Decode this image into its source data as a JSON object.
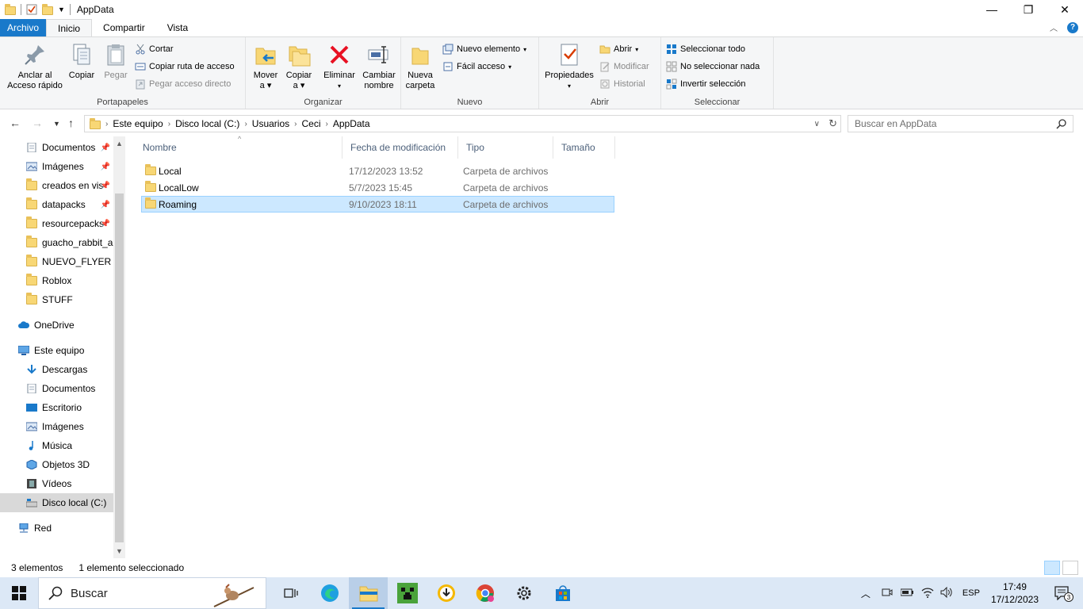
{
  "window": {
    "title": "AppData",
    "minimize": "—",
    "maximize": "❐",
    "close": "✕"
  },
  "ribbon_tabs": [
    "Archivo",
    "Inicio",
    "Compartir",
    "Vista"
  ],
  "ribbon": {
    "portapapeles": {
      "label": "Portapapeles",
      "pin": "Anclar al\nAcceso rápido",
      "pin_l1": "Anclar al",
      "pin_l2": "Acceso rápido",
      "copy": "Copiar",
      "paste": "Pegar",
      "cut": "Cortar",
      "copy_path": "Copiar ruta de acceso",
      "paste_shortcut": "Pegar acceso directo"
    },
    "organizar": {
      "label": "Organizar",
      "move_l1": "Mover",
      "move_l2": "a",
      "copy_l1": "Copiar",
      "copy_l2": "a",
      "delete": "Eliminar",
      "rename_l1": "Cambiar",
      "rename_l2": "nombre"
    },
    "nuevo": {
      "label": "Nuevo",
      "new_folder_l1": "Nueva",
      "new_folder_l2": "carpeta",
      "new_item": "Nuevo elemento",
      "easy_access": "Fácil acceso"
    },
    "abrir": {
      "label": "Abrir",
      "properties": "Propiedades",
      "open": "Abrir",
      "edit": "Modificar",
      "history": "Historial"
    },
    "seleccionar": {
      "label": "Seleccionar",
      "select_all": "Seleccionar todo",
      "select_none": "No seleccionar nada",
      "invert": "Invertir selección"
    }
  },
  "address": {
    "crumbs": [
      "Este equipo",
      "Disco local (C:)",
      "Usuarios",
      "Ceci",
      "AppData"
    ],
    "search_placeholder": "Buscar en AppData"
  },
  "nav": {
    "quick": [
      {
        "label": "Documentos",
        "pinned": true
      },
      {
        "label": "Imágenes",
        "pinned": true
      },
      {
        "label": "creados en vis",
        "pinned": true
      },
      {
        "label": "datapacks",
        "pinned": true
      },
      {
        "label": "resourcepacks",
        "pinned": true
      },
      {
        "label": "guacho_rabbit_a",
        "pinned": false
      },
      {
        "label": "NUEVO_FLYER",
        "pinned": false
      },
      {
        "label": "Roblox",
        "pinned": false
      },
      {
        "label": "STUFF",
        "pinned": false
      }
    ],
    "onedrive": "OneDrive",
    "this_pc": "Este equipo",
    "pc_items": [
      "Descargas",
      "Documentos",
      "Escritorio",
      "Imágenes",
      "Música",
      "Objetos 3D",
      "Vídeos",
      "Disco local (C:)"
    ],
    "network": "Red"
  },
  "columns": [
    "Nombre",
    "Fecha de modificación",
    "Tipo",
    "Tamaño"
  ],
  "files": [
    {
      "name": "Local",
      "date": "17/12/2023 13:52",
      "type": "Carpeta de archivos",
      "selected": false
    },
    {
      "name": "LocalLow",
      "date": "5/7/2023 15:45",
      "type": "Carpeta de archivos",
      "selected": false
    },
    {
      "name": "Roaming",
      "date": "9/10/2023 18:11",
      "type": "Carpeta de archivos",
      "selected": true
    }
  ],
  "status": {
    "count": "3 elementos",
    "selected": "1 elemento seleccionado"
  },
  "taskbar": {
    "search": "Buscar",
    "lang": "ESP",
    "time": "17:49",
    "date": "17/12/2023",
    "notifications": "3"
  },
  "colors": {
    "accent": "#1979ca",
    "selection": "#cce8ff",
    "folder": "#f8d775"
  }
}
